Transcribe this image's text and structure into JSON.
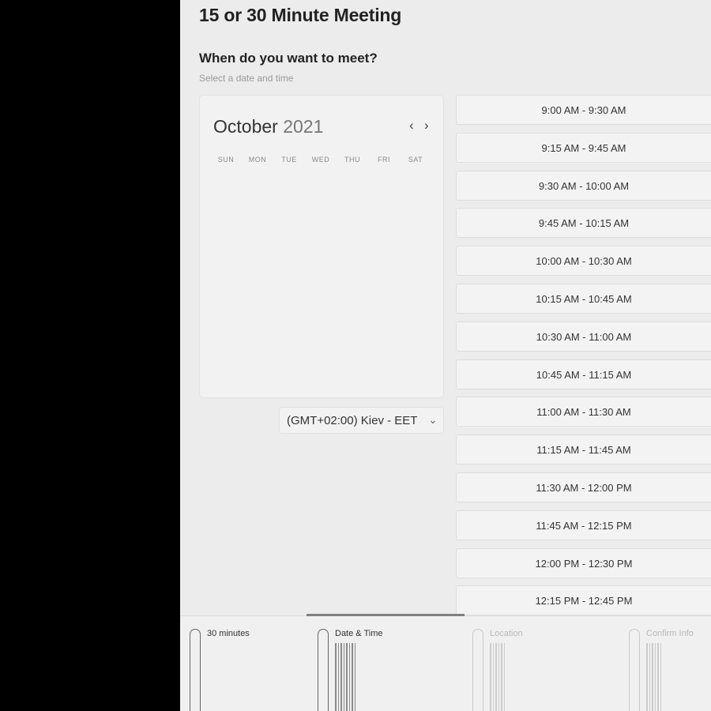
{
  "meeting": {
    "title": "15 or 30 Minute Meeting",
    "question": "When do you want to meet?",
    "subtitle": "Select a date and time"
  },
  "calendar": {
    "month": "October",
    "year": "2021",
    "prev_icon": "chevron-left-icon",
    "next_icon": "chevron-right-icon",
    "weekdays": [
      "SUN",
      "MON",
      "TUE",
      "WED",
      "THU",
      "FRI",
      "SAT"
    ]
  },
  "timezone": {
    "label": "(GMT+02:00) Kiev - EET",
    "icon": "chevron-down-icon"
  },
  "slots": [
    "9:00 AM - 9:30 AM",
    "9:15 AM - 9:45 AM",
    "9:30 AM - 10:00 AM",
    "9:45 AM - 10:15 AM",
    "10:00 AM - 10:30 AM",
    "10:15 AM - 10:45 AM",
    "10:30 AM - 11:00 AM",
    "10:45 AM - 11:15 AM",
    "11:00 AM - 11:30 AM",
    "11:15 AM - 11:45 AM",
    "11:30 AM - 12:00 PM",
    "11:45 AM - 12:15 PM",
    "12:00 PM - 12:30 PM",
    "12:15 PM - 12:45 PM"
  ],
  "steps": [
    {
      "label": "30 minutes",
      "icon": "clock-icon",
      "active": true
    },
    {
      "label": "Date & Time",
      "icon": "calendar-icon",
      "active": true
    },
    {
      "label": "Location",
      "icon": "location-pin-icon",
      "active": false
    },
    {
      "label": "Confirm Info",
      "icon": "checkbox-icon",
      "active": false
    }
  ],
  "progress": {
    "completed_steps": 2,
    "total_steps": 4
  },
  "colors": {
    "panel_bg": "#ececec",
    "side_bg": "#000000",
    "progress": "#808080"
  }
}
